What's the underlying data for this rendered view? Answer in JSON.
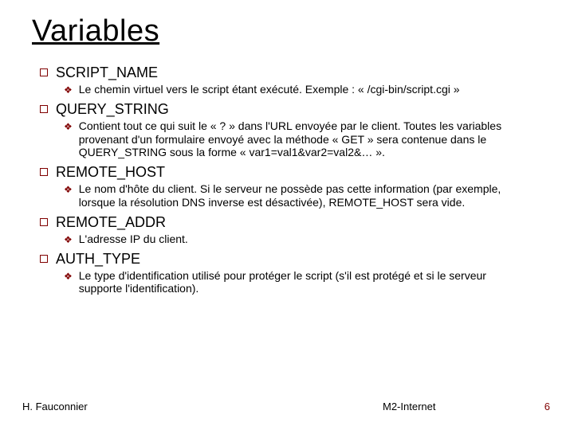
{
  "title": "Variables",
  "items": [
    {
      "heading": "SCRIPT_NAME",
      "sub": "Le chemin virtuel vers le script étant exécuté. Exemple : « /cgi-bin/script.cgi »"
    },
    {
      "heading": "QUERY_STRING",
      "sub": "Contient tout ce qui suit le « ? » dans l'URL envoyée par le client. Toutes les variables provenant d'un formulaire envoyé avec la méthode « GET » sera contenue dans le QUERY_STRING sous la forme « var1=val1&var2=val2&… »."
    },
    {
      "heading": "REMOTE_HOST",
      "sub": "Le nom d'hôte du client. Si le serveur ne possède pas cette information (par exemple, lorsque la résolution DNS inverse est désactivée), REMOTE_HOST sera vide."
    },
    {
      "heading": "REMOTE_ADDR",
      "sub": "L'adresse IP du client."
    },
    {
      "heading": "AUTH_TYPE",
      "sub": "Le type d'identification utilisé pour protéger le script (s'il est protégé et si le serveur supporte l'identification)."
    }
  ],
  "footer": {
    "left": "H. Fauconnier",
    "mid": "M2-Internet",
    "right": "6"
  }
}
